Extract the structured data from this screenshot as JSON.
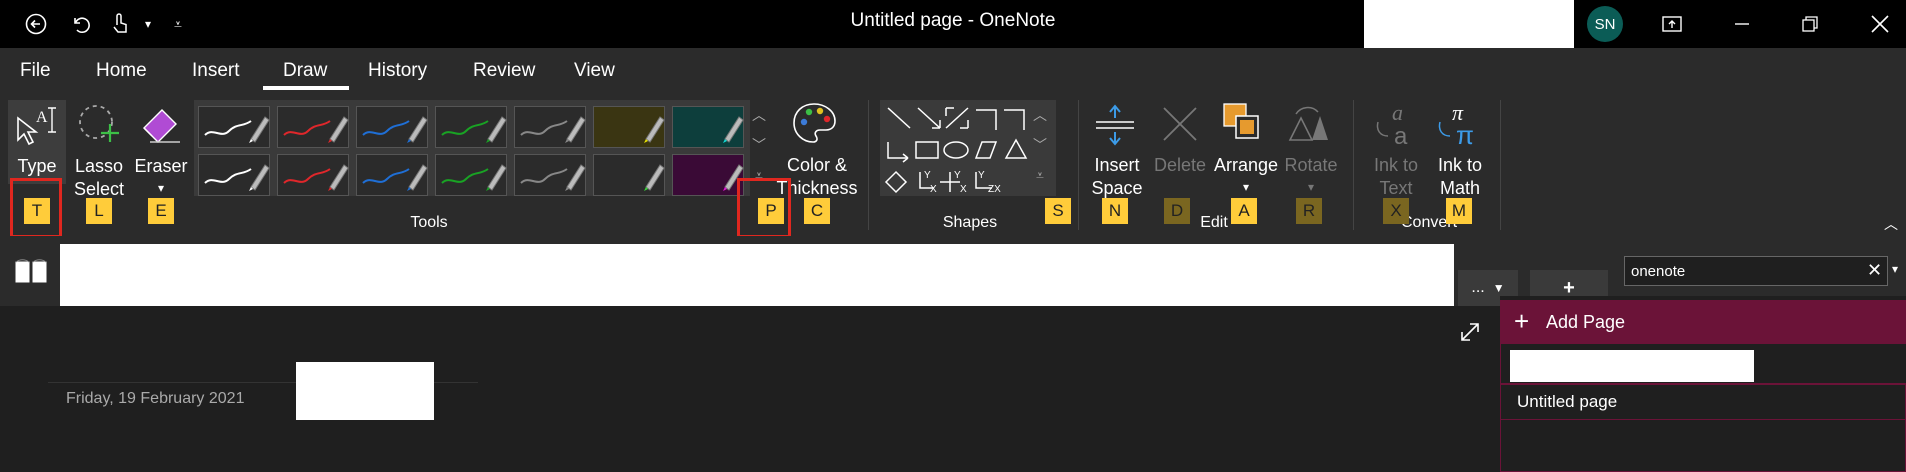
{
  "app": {
    "title": "Untitled page  -  OneNote",
    "user_initials": "SN"
  },
  "quick_access": {
    "back_icon": "back-arrow-icon",
    "undo_icon": "undo-icon",
    "touch_icon": "touch-mode-icon",
    "more_icon": "customize-icon"
  },
  "menu_tabs": [
    "File",
    "Home",
    "Insert",
    "Draw",
    "History",
    "Review",
    "View"
  ],
  "active_tab": "Draw",
  "ribbon": {
    "type_label": "Type",
    "lasso_label_1": "Lasso",
    "lasso_label_2": "Select",
    "eraser_label": "Eraser",
    "color_label_1": "Color &",
    "color_label_2": "Thickness",
    "tools_group": "Tools",
    "shapes_group": "Shapes",
    "insert_space_1": "Insert",
    "insert_space_2": "Space",
    "delete_label": "Delete",
    "arrange_label": "Arrange",
    "rotate_label": "Rotate",
    "edit_group": "Edit",
    "ink_to_text_1": "Ink to",
    "ink_to_text_2": "Text",
    "ink_to_math_1": "Ink to",
    "ink_to_math_2": "Math",
    "convert_group": "Convert",
    "keys": {
      "type": "T",
      "lasso": "L",
      "eraser": "E",
      "pens": "P",
      "color": "C",
      "shapes": "S",
      "insert_space": "N",
      "delete": "D",
      "arrange": "A",
      "rotate": "R",
      "ink_to_text": "X",
      "ink_to_math": "M"
    },
    "pen_colors": [
      "#ffffff",
      "#e0272b",
      "#1f6fd6",
      "#19a324",
      "#888888",
      "#e6e200",
      "#12d9d4",
      "#ffffff",
      "#e0272b",
      "#1f6fd6",
      "#19a324",
      "#888888",
      "#39d63a",
      "#e21ad8"
    ]
  },
  "notebook": {
    "tab_more": "...",
    "add_section": "+",
    "search_value": "onenote"
  },
  "page": {
    "date": "Friday, 19 February 2021"
  },
  "pages_panel": {
    "add_page": "Add Page",
    "page_1": "Untitled page"
  },
  "colors": {
    "accent_pink": "#6b1338",
    "key_yellow": "#ffcc3a",
    "highlight_red": "#e0271f"
  }
}
